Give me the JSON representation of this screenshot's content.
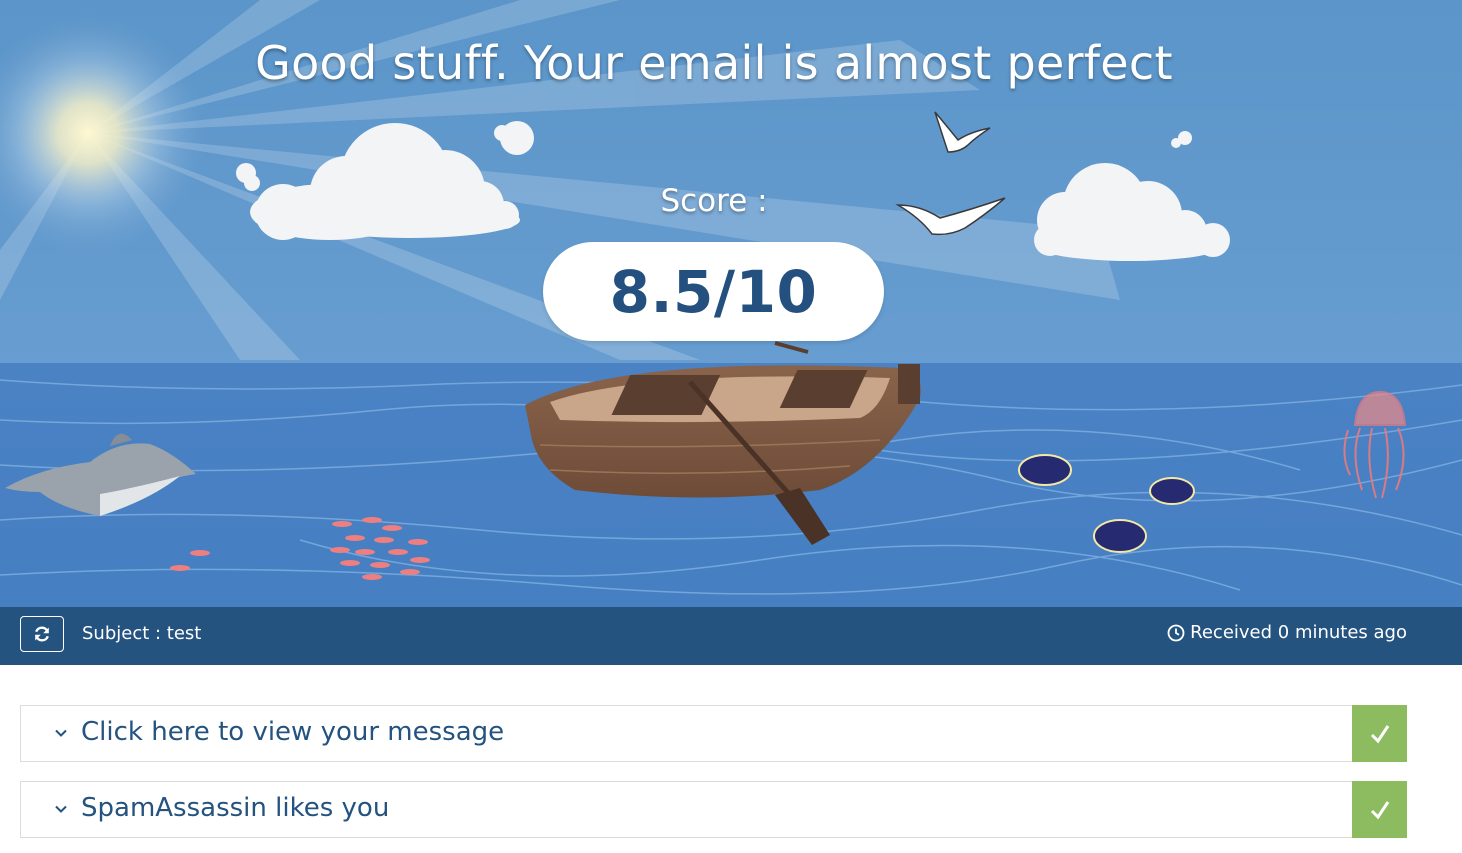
{
  "hero": {
    "headline": "Good stuff. Your email is almost perfect",
    "score_label": "Score :",
    "score_value": "8.5/10"
  },
  "infobar": {
    "refresh_icon": "refresh-icon",
    "subject": "Subject : test",
    "clock_icon": "clock-icon",
    "received": "Received 0 minutes ago"
  },
  "panels": [
    {
      "title": "Click here to view your message",
      "status_icon": "check-icon",
      "status_color": "#8dbb5f"
    },
    {
      "title": "SpamAssassin likes you",
      "status_icon": "check-icon",
      "status_color": "#8dbb5f"
    }
  ],
  "colors": {
    "brand_dark": "#245380",
    "score_text": "#23507e",
    "success": "#8dbb5f",
    "sky": "#5b95c9",
    "sea": "#4a82c4"
  }
}
